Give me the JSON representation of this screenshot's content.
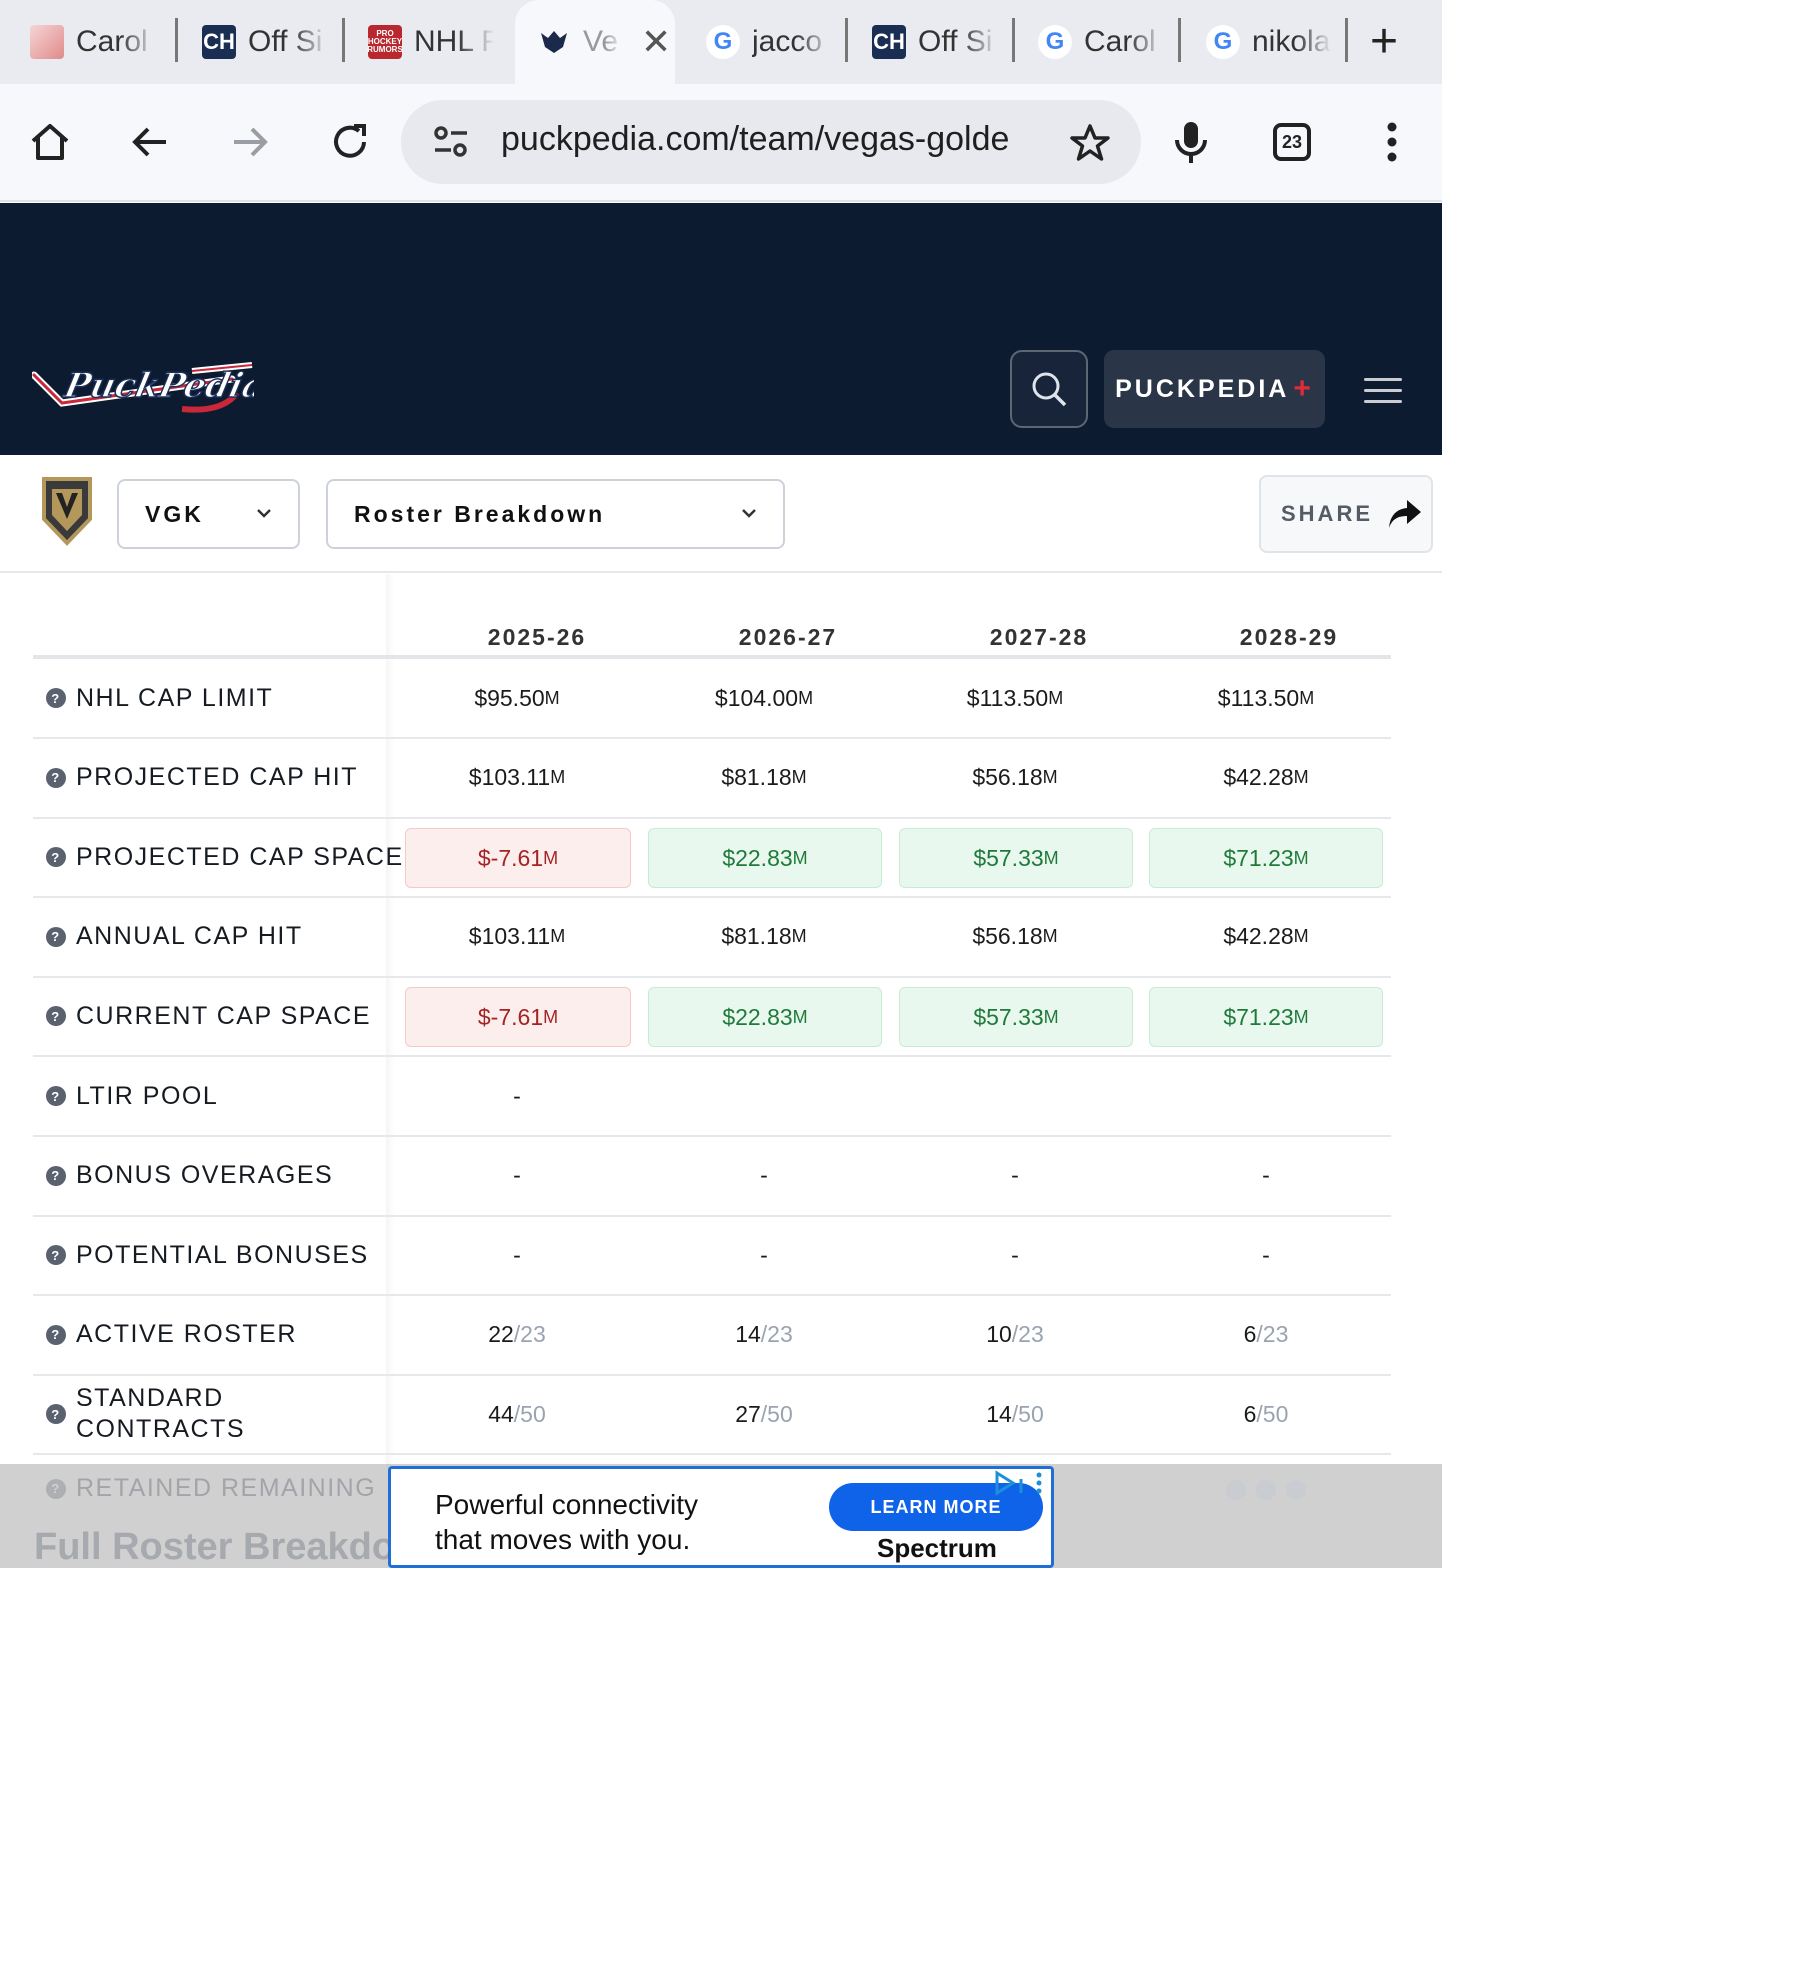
{
  "browser": {
    "tabs": [
      {
        "label": "Carol",
        "favicon": "carolina-hurricanes-favicon"
      },
      {
        "label": "Off Si",
        "favicon": "ch-favicon"
      },
      {
        "label": "NHL F",
        "favicon": "pro-hockey-rumors-favicon"
      },
      {
        "label": "Ve",
        "favicon": "vegas-golden-knights-favicon",
        "active": true
      },
      {
        "label": "jacco",
        "favicon": "google-favicon"
      },
      {
        "label": "Off Si",
        "favicon": "ch-favicon"
      },
      {
        "label": "Carol",
        "favicon": "google-favicon"
      },
      {
        "label": "nikola",
        "favicon": "google-favicon"
      }
    ],
    "url": "puckpedia.com/team/vegas-golde",
    "tab_count": "23"
  },
  "site": {
    "logo_text": "PuckPedia",
    "plus_label": "PUCKPEDIA",
    "plus_symbol": "+",
    "team_select": "VGK",
    "view_select": "Roster Breakdown",
    "share_label": "SHARE"
  },
  "table": {
    "years": [
      "2025-26",
      "2026-27",
      "2027-28",
      "2028-29"
    ],
    "rows": [
      {
        "label": "NHL CAP LIMIT",
        "type": "money",
        "values": [
          [
            "$95.50",
            "M"
          ],
          [
            "$104.00",
            "M"
          ],
          [
            "$113.50",
            "M"
          ],
          [
            "$113.50",
            "M"
          ]
        ]
      },
      {
        "label": "PROJECTED CAP HIT",
        "type": "money",
        "values": [
          [
            "$103.11",
            "M"
          ],
          [
            "$81.18",
            "M"
          ],
          [
            "$56.18",
            "M"
          ],
          [
            "$42.28",
            "M"
          ]
        ]
      },
      {
        "label": "PROJECTED CAP SPACE",
        "type": "pill",
        "values": [
          [
            "$-7.61",
            "M",
            "neg"
          ],
          [
            "$22.83",
            "M",
            "pos"
          ],
          [
            "$57.33",
            "M",
            "pos"
          ],
          [
            "$71.23",
            "M",
            "pos"
          ]
        ]
      },
      {
        "label": "ANNUAL CAP HIT",
        "type": "money",
        "values": [
          [
            "$103.11",
            "M"
          ],
          [
            "$81.18",
            "M"
          ],
          [
            "$56.18",
            "M"
          ],
          [
            "$42.28",
            "M"
          ]
        ]
      },
      {
        "label": "CURRENT CAP SPACE",
        "type": "pill",
        "values": [
          [
            "$-7.61",
            "M",
            "neg"
          ],
          [
            "$22.83",
            "M",
            "pos"
          ],
          [
            "$57.33",
            "M",
            "pos"
          ],
          [
            "$71.23",
            "M",
            "pos"
          ]
        ]
      },
      {
        "label": "LTIR POOL",
        "type": "text",
        "values": [
          "-",
          "",
          "",
          ""
        ]
      },
      {
        "label": "BONUS OVERAGES",
        "type": "text",
        "values": [
          "-",
          "-",
          "-",
          "-"
        ]
      },
      {
        "label": "POTENTIAL BONUSES",
        "type": "text",
        "values": [
          "-",
          "-",
          "-",
          "-"
        ]
      },
      {
        "label": "ACTIVE ROSTER",
        "type": "ratio",
        "values": [
          [
            "22",
            "/23"
          ],
          [
            "14",
            "/23"
          ],
          [
            "10",
            "/23"
          ],
          [
            "6",
            "/23"
          ]
        ]
      },
      {
        "label": "STANDARD CONTRACTS",
        "type": "ratio",
        "label_lines": [
          "STANDARD",
          "CONTRACTS"
        ],
        "values": [
          [
            "44",
            "/50"
          ],
          [
            "27",
            "/50"
          ],
          [
            "14",
            "/50"
          ],
          [
            "6",
            "/50"
          ]
        ]
      }
    ],
    "partial_row_label": "RETAINED REMAINING"
  },
  "section_title": "Full Roster Breakdown",
  "ad": {
    "line1": "Powerful connectivity",
    "line2": "that moves with you.",
    "cta": "LEARN MORE",
    "brand": "Spectrum"
  },
  "colors": {
    "header_bg": "#0c1b2f",
    "negative": "#a32424",
    "positive": "#1f7a3a",
    "accent_red": "#e02b38"
  }
}
